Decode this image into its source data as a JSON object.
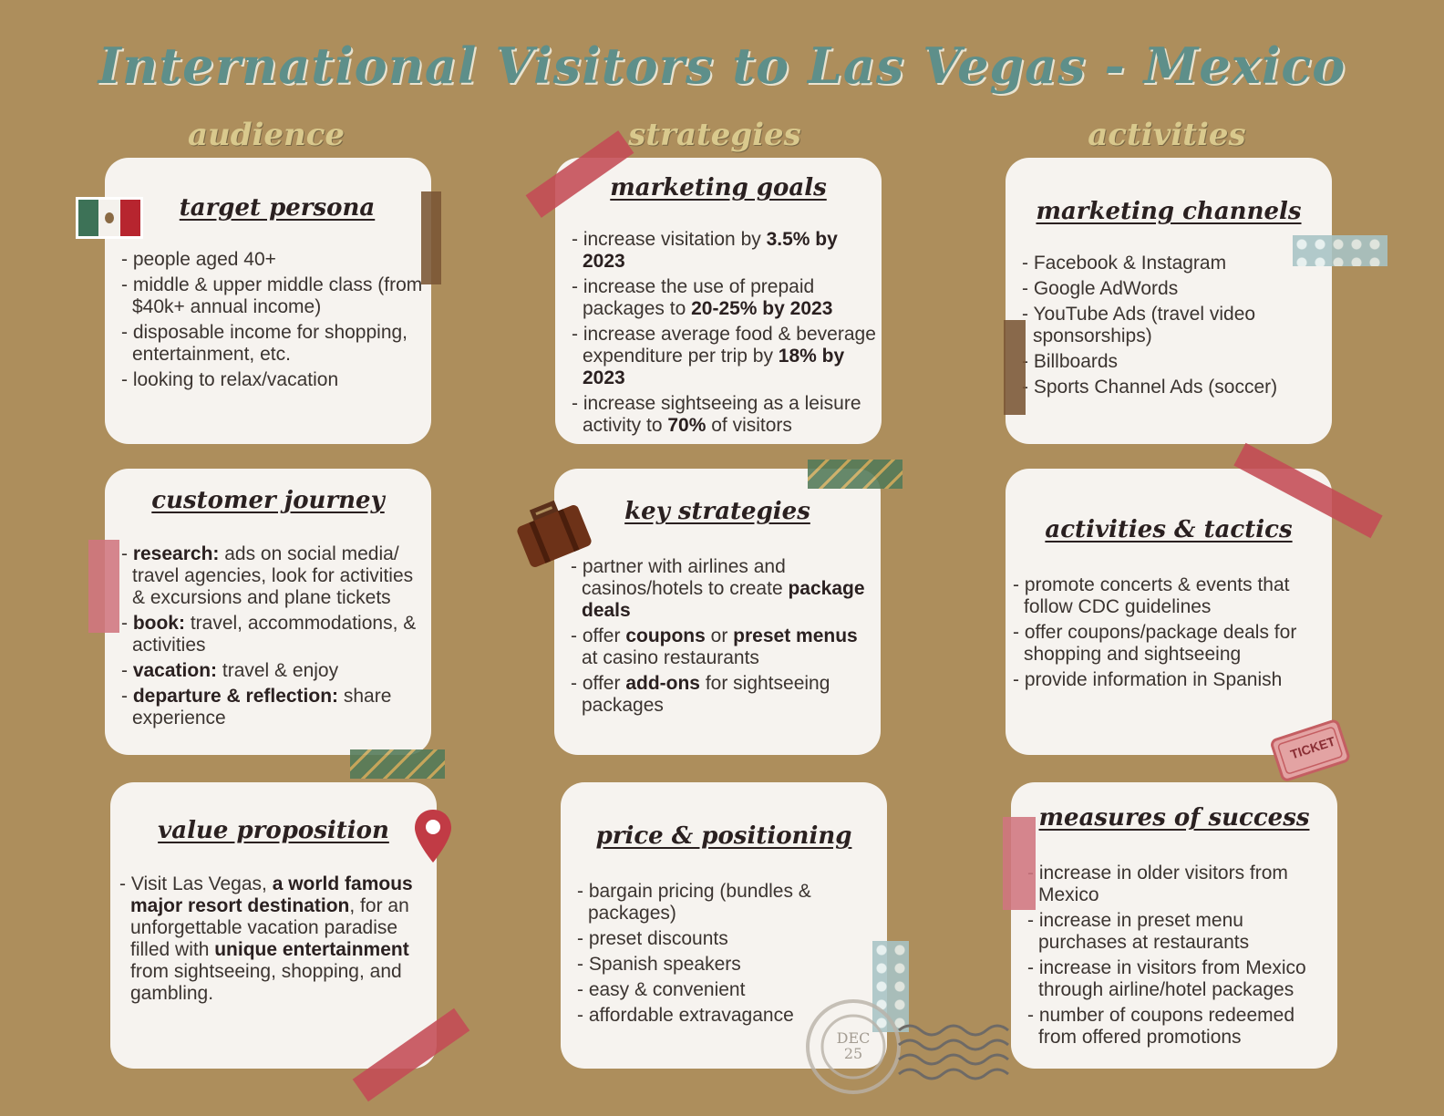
{
  "title": "International Visitors to Las Vegas - Mexico",
  "columns": {
    "audience": "audience",
    "strategies": "strategies",
    "activities": "activities"
  },
  "colors": {
    "title": "#5e8f8a",
    "column_head": "#d9c98d",
    "background": "#ad8e5c",
    "card": "#f6f3ef",
    "tape_red": "#c44b55"
  },
  "icons": [
    "mexico-flag-icon",
    "suitcase-icon",
    "map-pin-icon",
    "ticket-icon",
    "postmark-stamp-icon"
  ],
  "ticket_text": "TICKET",
  "stamp_text": "DEC 25",
  "cards": {
    "target_persona": {
      "title": "target persona",
      "items": [
        "- people aged 40+",
        "- middle & upper middle class (from $40k+ annual income)",
        "- disposable income for shopping, entertainment, etc.",
        "- looking to relax/vacation"
      ]
    },
    "marketing_goals": {
      "title": "marketing goals",
      "items": [
        {
          "pre": "- increase visitation by ",
          "bold": "3.5% by 2023",
          "post": ""
        },
        {
          "pre": "- increase the use of prepaid packages to ",
          "bold": "20-25% by 2023",
          "post": ""
        },
        {
          "pre": "- increase average food & beverage expenditure per trip by ",
          "bold": "18% by 2023",
          "post": ""
        },
        {
          "pre": "- increase sightseeing as a leisure activity to ",
          "bold": "70%",
          "post": " of visitors"
        }
      ]
    },
    "marketing_channels": {
      "title": "marketing channels",
      "items": [
        "- Facebook & Instagram",
        "- Google AdWords",
        "- YouTube Ads (travel video sponsorships)",
        "- Billboards",
        "- Sports Channel Ads (soccer)"
      ]
    },
    "customer_journey": {
      "title": "customer journey",
      "items": [
        {
          "pre": "- ",
          "bold": "research:",
          "post": " ads on social media/ travel agencies, look for activities & excursions and plane tickets"
        },
        {
          "pre": "- ",
          "bold": "book:",
          "post": " travel, accommodations, & activities"
        },
        {
          "pre": "- ",
          "bold": "vacation:",
          "post": " travel & enjoy"
        },
        {
          "pre": "- ",
          "bold": "departure & reflection:",
          "post": " share experience"
        }
      ]
    },
    "key_strategies": {
      "title": "key strategies",
      "items": [
        {
          "pre": "- partner with airlines and casinos/hotels to create ",
          "bold": "package deals",
          "post": ""
        },
        {
          "pre": "- offer ",
          "bold": "coupons",
          "post": " or ",
          "bold2": "preset menus",
          "post2": " at casino restaurants"
        },
        {
          "pre": "- offer ",
          "bold": "add-ons",
          "post": " for sightseeing packages"
        }
      ]
    },
    "activities_tactics": {
      "title": "activities & tactics",
      "items": [
        "- promote concerts & events that follow CDC guidelines",
        "- offer coupons/package deals for shopping and sightseeing",
        "- provide information in Spanish"
      ]
    },
    "value_proposition": {
      "title": "value proposition",
      "pre": "- Visit Las Vegas, ",
      "bold1": "a world famous major resort destination",
      "mid": ", for an unforgettable vacation paradise filled with ",
      "bold2": "unique entertainment",
      "post": " from sightseeing, shopping, and gambling."
    },
    "price_positioning": {
      "title": "price & positioning",
      "items": [
        "- bargain pricing (bundles & packages)",
        "- preset discounts",
        "- Spanish speakers",
        "- easy & convenient",
        "- affordable extravagance"
      ]
    },
    "measures_success": {
      "title": "measures of success",
      "items": [
        "- increase in older visitors from Mexico",
        "- increase in preset menu purchases at restaurants",
        "- increase in visitors from Mexico through airline/hotel packages",
        "- number of coupons redeemed from offered promotions"
      ]
    }
  }
}
